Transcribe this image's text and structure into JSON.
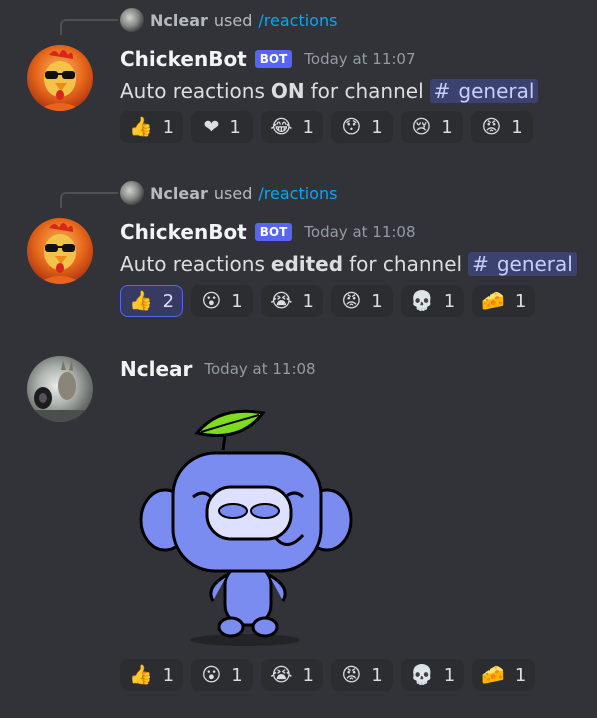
{
  "messages": [
    {
      "reply_user": "Nclear",
      "reply_used": "used",
      "reply_command": "/reactions",
      "author": "ChickenBot",
      "bot_tag": "BOT",
      "time": "Today at 11:07",
      "text_before": "Auto reactions",
      "text_bold": "ON",
      "text_after": "for channel",
      "channel_hash": "#",
      "channel": "general",
      "reactions": [
        {
          "emoji": "👍",
          "count": "1",
          "mine": false
        },
        {
          "emoji": "❤",
          "count": "1",
          "mine": false
        },
        {
          "emoji": "😂",
          "count": "1",
          "mine": false
        },
        {
          "emoji": "😯",
          "count": "1",
          "mine": false
        },
        {
          "emoji": "😢",
          "count": "1",
          "mine": false
        },
        {
          "emoji": "😡",
          "count": "1",
          "mine": false
        }
      ]
    },
    {
      "reply_user": "Nclear",
      "reply_used": "used",
      "reply_command": "/reactions",
      "author": "ChickenBot",
      "bot_tag": "BOT",
      "time": "Today at 11:08",
      "text_before": "Auto reactions",
      "text_bold": "edited",
      "text_after": "for channel",
      "channel_hash": "#",
      "channel": "general",
      "reactions": [
        {
          "emoji": "👍",
          "count": "2",
          "mine": true
        },
        {
          "emoji": "😮",
          "count": "1",
          "mine": false
        },
        {
          "emoji": "😭",
          "count": "1",
          "mine": false
        },
        {
          "emoji": "😡",
          "count": "1",
          "mine": false
        },
        {
          "emoji": "💀",
          "count": "1",
          "mine": false
        },
        {
          "emoji": "🧀",
          "count": "1",
          "mine": false
        }
      ]
    },
    {
      "author": "Nclear",
      "time": "Today at 11:08",
      "reactions": [
        {
          "emoji": "👍",
          "count": "1",
          "mine": false
        },
        {
          "emoji": "😮",
          "count": "1",
          "mine": false
        },
        {
          "emoji": "😭",
          "count": "1",
          "mine": false
        },
        {
          "emoji": "😡",
          "count": "1",
          "mine": false
        },
        {
          "emoji": "💀",
          "count": "1",
          "mine": false
        },
        {
          "emoji": "🧀",
          "count": "1",
          "mine": false
        }
      ]
    }
  ],
  "colors": {
    "background": "#313338",
    "bot_tag": "#5865f2",
    "command_link": "#00a8fc",
    "mention_bg": "#3c4270",
    "reaction_bg": "#2b2d31",
    "reaction_mine_bg": "#373a63"
  },
  "icons": {
    "avatar_bot": "chicken-with-sunglasses-avatar",
    "avatar_user": "kangaroo-photo-avatar",
    "sticker": "blue-discord-wumpus-with-leaf-sticker"
  }
}
